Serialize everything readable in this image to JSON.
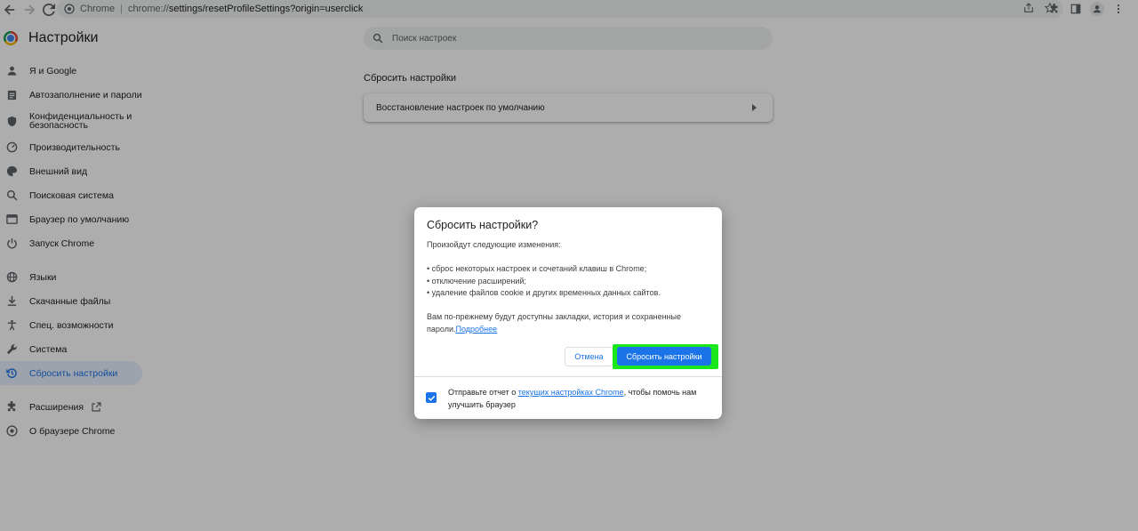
{
  "browser": {
    "omnibox_app": "Chrome",
    "url_scheme": "chrome://",
    "url_path": "settings/resetProfileSettings?origin=userclick"
  },
  "header": {
    "title": "Настройки"
  },
  "search": {
    "placeholder": "Поиск настроек"
  },
  "sidebar": {
    "items": [
      {
        "label": "Я и Google",
        "icon": "person-icon"
      },
      {
        "label": "Автозаполнение и пароли",
        "icon": "clipboard-icon"
      },
      {
        "label": "Конфиденциальность и безопасность",
        "icon": "shield-icon"
      },
      {
        "label": "Производительность",
        "icon": "speedometer-icon"
      },
      {
        "label": "Внешний вид",
        "icon": "palette-icon"
      },
      {
        "label": "Поисковая система",
        "icon": "search-icon"
      },
      {
        "label": "Браузер по умолчанию",
        "icon": "browser-icon"
      },
      {
        "label": "Запуск Chrome",
        "icon": "power-icon"
      },
      {
        "label": "Языки",
        "icon": "globe-icon"
      },
      {
        "label": "Скачанные файлы",
        "icon": "download-icon"
      },
      {
        "label": "Спец. возможности",
        "icon": "accessibility-icon"
      },
      {
        "label": "Система",
        "icon": "wrench-icon"
      },
      {
        "label": "Сбросить настройки",
        "icon": "history-icon"
      },
      {
        "label": "Расширения",
        "icon": "puzzle-icon"
      },
      {
        "label": "О браузере Chrome",
        "icon": "chrome-icon"
      }
    ]
  },
  "main": {
    "section_title": "Сбросить настройки",
    "card_label": "Восстановление настроек по умолчанию"
  },
  "dialog": {
    "title": "Сбросить настройки?",
    "intro": "Произойдут следующие изменения:",
    "bullets": [
      "• сброс некоторых настроек и сочетаний клавиш в Chrome;",
      "• отключение расширений;",
      "• удаление файлов cookie и других временных данных сайтов."
    ],
    "note": "Вам по-прежнему будут доступны закладки, история и сохраненные пароли.",
    "learn_more": "Подробнее",
    "cancel_label": "Отмена",
    "reset_label": "Сбросить настройки",
    "report_prefix": "Отправьте отчет о ",
    "report_link": "текущих настройках Chrome",
    "report_suffix": ", чтобы помочь нам улучшить браузер",
    "report_checked": true
  },
  "colors": {
    "accent": "#1a73e8",
    "highlight": "#1be81b",
    "active_nav_bg": "#e8f0fe"
  }
}
